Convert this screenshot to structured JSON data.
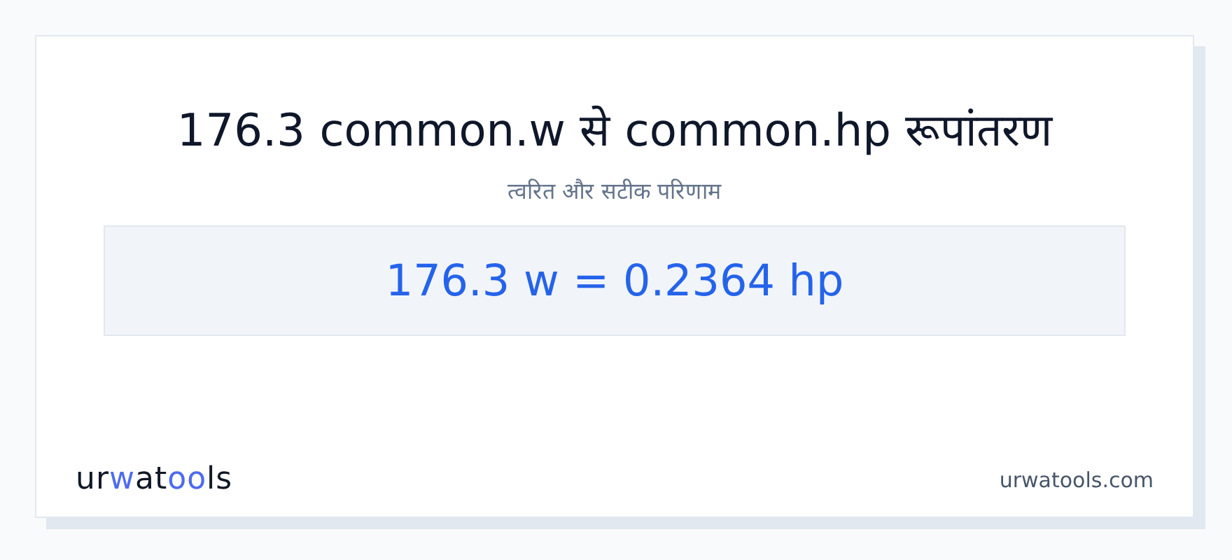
{
  "title": "176.3 common.w से common.hp रूपांतरण",
  "subtitle": "त्वरित और सटीक परिणाम",
  "result": "176.3 w = 0.2364 hp",
  "logo": [
    {
      "text": "ur",
      "accent": false
    },
    {
      "text": "w",
      "accent": true
    },
    {
      "text": "at",
      "accent": false
    },
    {
      "text": "oo",
      "accent": true
    },
    {
      "text": "ls",
      "accent": false
    }
  ],
  "site": "urwatools.com"
}
